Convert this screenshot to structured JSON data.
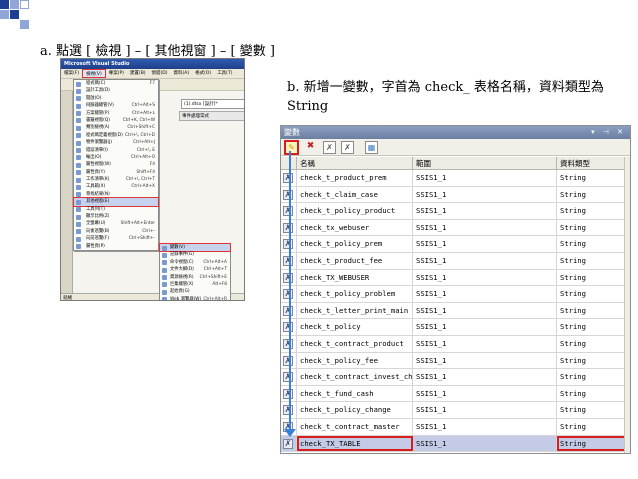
{
  "captions": {
    "a": "a. 點選 [ 檢視 ] – [ 其他視窗 ] – [ 變數 ]",
    "b": "b. 新增一變數，字首為 check_ 表格名稱，資料類型為 String"
  },
  "vs": {
    "title": "Microsoft Visual Studio",
    "menubar": [
      "檔案(F)",
      "檢視(V)",
      "專案(P)",
      "建置(B)",
      "偵錯(D)",
      "資料(A)",
      "格式(O)",
      "工具(T)"
    ],
    "active_menu_index": 1,
    "tabs": [
      "(1).dtsx [設計]*",
      "事件處理常式"
    ],
    "status": "就緒"
  },
  "view_menu": [
    {
      "label": "程式碼(C)",
      "shortcut": "F7"
    },
    {
      "label": "設計工具(D)",
      "shortcut": ""
    },
    {
      "label": "開啟(O)",
      "shortcut": ""
    },
    {
      "label": "伺服器總管(V)",
      "shortcut": "Ctrl+Alt+S"
    },
    {
      "label": "方案總管(P)",
      "shortcut": "Ctrl+Alt+L"
    },
    {
      "label": "書籤視窗(Q)",
      "shortcut": "Ctrl+K, Ctrl+W"
    },
    {
      "label": "類別檢視(A)",
      "shortcut": "Ctrl+Shift+C"
    },
    {
      "label": "程式碼定義視窗(D)",
      "shortcut": "Ctrl+\\, Ctrl+D"
    },
    {
      "label": "物件瀏覽器(J)",
      "shortcut": "Ctrl+Alt+J"
    },
    {
      "label": "錯誤清單(I)",
      "shortcut": "Ctrl+\\, E"
    },
    {
      "label": "輸出(O)",
      "shortcut": "Ctrl+Alt+O"
    },
    {
      "label": "屬性視窗(W)",
      "shortcut": "F4"
    },
    {
      "label": "屬性頁(Y)",
      "shortcut": "Shift+F4"
    },
    {
      "label": "工作清單(K)",
      "shortcut": "Ctrl+\\, Ctrl+T"
    },
    {
      "label": "工具箱(X)",
      "shortcut": "Ctrl+Alt+X"
    },
    {
      "label": "尋找結果(N)",
      "shortcut": ""
    },
    {
      "label": "其他視窗(E)",
      "shortcut": ""
    },
    {
      "label": "工具列(T)",
      "shortcut": ""
    },
    {
      "label": "顯示比例(Z)",
      "shortcut": ""
    },
    {
      "label": "全螢幕(U)",
      "shortcut": "Shift+Alt+Enter"
    },
    {
      "label": "向後巡覽(B)",
      "shortcut": "Ctrl+-"
    },
    {
      "label": "向前巡覽(F)",
      "shortcut": "Ctrl+Shift+-"
    },
    {
      "label": "屬性頁(P)",
      "shortcut": ""
    }
  ],
  "other_windows_submenu": [
    {
      "label": "變數(V)",
      "shortcut": ""
    },
    {
      "label": "記錄事件(G)",
      "shortcut": ""
    },
    {
      "label": "命令視窗(C)",
      "shortcut": "Ctrl+Alt+A"
    },
    {
      "label": "文件大綱(D)",
      "shortcut": "Ctrl+Alt+T"
    },
    {
      "label": "資源檢視(R)",
      "shortcut": "Ctrl+Shift+E"
    },
    {
      "label": "巨集總管(X)",
      "shortcut": "Alt+F8"
    },
    {
      "label": "起始頁(G)",
      "shortcut": ""
    },
    {
      "label": "Web 瀏覽器(W)",
      "shortcut": "Ctrl+Alt+R"
    }
  ],
  "variables_window": {
    "title": "變數",
    "controls": "▾ ⊣ ✕",
    "toolbar": {
      "add": "✎",
      "delete": "✖",
      "x1": "✗",
      "x2": "✗",
      "grid": "▦"
    },
    "columns": [
      "名稱",
      "範圍",
      "資料類型"
    ],
    "row_icon": "✗",
    "rows": [
      {
        "name": "check_t_product_prem",
        "scope": "SSIS1_1",
        "type": "String"
      },
      {
        "name": "check_t_claim_case",
        "scope": "SSIS1_1",
        "type": "String"
      },
      {
        "name": "check_t_policy_product",
        "scope": "SSIS1_1",
        "type": "String"
      },
      {
        "name": "check_tx_webuser",
        "scope": "SSIS1_1",
        "type": "String"
      },
      {
        "name": "check_t_policy_prem",
        "scope": "SSIS1_1",
        "type": "String"
      },
      {
        "name": "check_t_product_fee",
        "scope": "SSIS1_1",
        "type": "String"
      },
      {
        "name": "check_TX_WEBUSER",
        "scope": "SSIS1_1",
        "type": "String"
      },
      {
        "name": "check_t_policy_problem",
        "scope": "SSIS1_1",
        "type": "String"
      },
      {
        "name": "check_t_letter_print_main",
        "scope": "SSIS1_1",
        "type": "String"
      },
      {
        "name": "check_t_policy",
        "scope": "SSIS1_1",
        "type": "String"
      },
      {
        "name": "check_t_contract_product",
        "scope": "SSIS1_1",
        "type": "String"
      },
      {
        "name": "check_t_policy_fee",
        "scope": "SSIS1_1",
        "type": "String"
      },
      {
        "name": "check_t_contract_invest_chg",
        "scope": "SSIS1_1",
        "type": "String"
      },
      {
        "name": "check_t_fund_cash",
        "scope": "SSIS1_1",
        "type": "String"
      },
      {
        "name": "check_t_policy_change",
        "scope": "SSIS1_1",
        "type": "String"
      },
      {
        "name": "check_t_contract_master",
        "scope": "SSIS1_1",
        "type": "String"
      },
      {
        "name": "check_TX_TABLE",
        "scope": "SSIS1_1",
        "type": "String"
      }
    ]
  },
  "colors": {
    "highlight_red": "#d81d1d",
    "arrow_blue": "#3a7fd9",
    "deco_blue": "#1c3f94",
    "deco_light": "#8fa6d6"
  }
}
